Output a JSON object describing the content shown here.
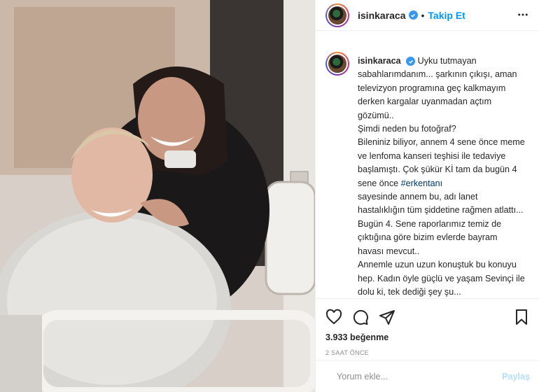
{
  "post": {
    "username": "isinkaraca",
    "verified": true,
    "follow_label": "Takip Et",
    "caption": "Uyku tutmayan sabahlarımdanım... şarkının çıkışı, aman televizyon programına geç kalkmayım derken kargalar uyanmadan açtım gözümü..\nŞimdi neden bu fotoğraf?\nBileniniz biliyor, annem 4 sene önce meme ve lenfoma kanseri teşhisi ile tedaviye başlamıştı. Çok şükür Kİ tam da bugün 4 sene önce ",
    "hashtag": "#erkentanı",
    "caption_rest": "\nsayesinde annem bu, adı lanet hastalıklığın tüm şiddetine rağmen atlattı...\nBugün 4. Sene raporlarımız temiz de çıktığına göre bizim evlerde bayram havası mevcut..\nAnnemle uzun uzun konuştuk bu konuyu hep. Kadın öyle güçlü ve yaşam Sevinçi ile dolu ki, tek dediği şey şu...",
    "likes": "3.933 beğenme",
    "timestamp": "2 SAAT ÖNCE"
  },
  "comment": {
    "placeholder": "Yorum ekle...",
    "post_label": "Paylaş"
  },
  "colors": {
    "accent": "#0095f6",
    "verified": "#3897f0",
    "post_disabled": "#b2dffc"
  },
  "icons": [
    "more-options-icon",
    "heart-icon",
    "comment-icon",
    "share-icon",
    "bookmark-icon",
    "verified-badge-icon"
  ]
}
